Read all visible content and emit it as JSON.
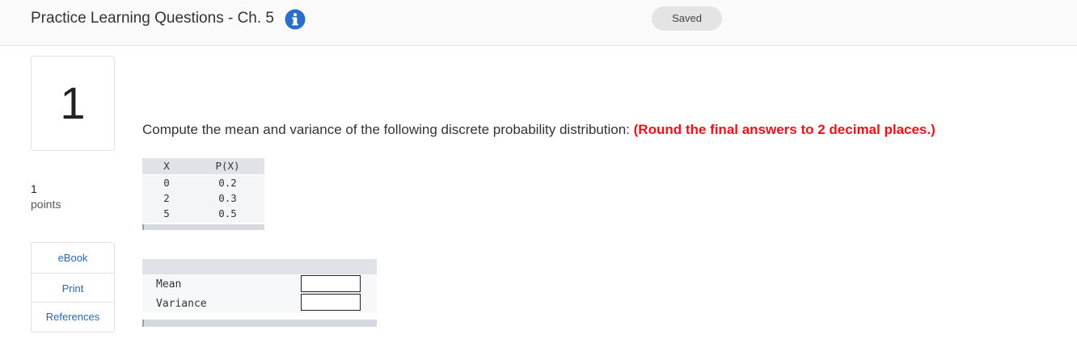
{
  "header": {
    "title": "Practice Learning Questions - Ch. 5",
    "info_icon": "info-icon",
    "saved_label": "Saved"
  },
  "sidebar": {
    "question_number": "1",
    "points_value": "1",
    "points_label": "points",
    "tools": [
      "eBook",
      "Print",
      "References"
    ]
  },
  "question": {
    "prompt": "Compute the mean and variance of the following discrete probability distribution: ",
    "instruction": "(Round the final answers to 2 decimal places.)"
  },
  "distribution": {
    "headers": [
      "X",
      "P(X)"
    ],
    "rows": [
      [
        "0",
        "0.2"
      ],
      [
        "2",
        "0.3"
      ],
      [
        "5",
        "0.5"
      ]
    ]
  },
  "answers": {
    "rows": [
      {
        "label": "Mean",
        "value": ""
      },
      {
        "label": "Variance",
        "value": ""
      }
    ]
  },
  "colors": {
    "link": "#2a68b0",
    "emphasis": "#e8141c",
    "info_icon": "#2a6fc9"
  }
}
